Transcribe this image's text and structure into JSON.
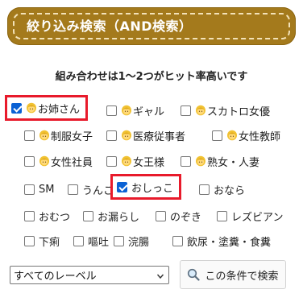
{
  "header": {
    "title": "絞り込み検索（AND検索）"
  },
  "subtitle": "組み合わせは1～2つがヒット率高いです",
  "rows": [
    [
      {
        "label": "お姉さん",
        "checked": true,
        "emoji": true,
        "highlight": true
      },
      {
        "label": "ギャル",
        "checked": false,
        "emoji": true
      },
      {
        "label": "スカトロ女優",
        "checked": false,
        "emoji": true
      }
    ],
    [
      {
        "label": "制服女子",
        "checked": false,
        "emoji": true
      },
      {
        "label": "医療従事者",
        "checked": false,
        "emoji": true
      },
      {
        "label": "女性教師",
        "checked": false,
        "emoji": true
      }
    ],
    [
      {
        "label": "女性社員",
        "checked": false,
        "emoji": true
      },
      {
        "label": "女王様",
        "checked": false,
        "emoji": true
      },
      {
        "label": "熟女・人妻",
        "checked": false,
        "emoji": true
      }
    ],
    [
      {
        "label": "SM",
        "checked": false,
        "emoji": false
      },
      {
        "label": "うんこ",
        "checked": false,
        "emoji": false
      },
      {
        "label": "おしっこ",
        "checked": true,
        "emoji": false,
        "highlight": true
      },
      {
        "label": "おなら",
        "checked": false,
        "emoji": false
      }
    ],
    [
      {
        "label": "おむつ",
        "checked": false,
        "emoji": false
      },
      {
        "label": "お漏らし",
        "checked": false,
        "emoji": false
      },
      {
        "label": "のぞき",
        "checked": false,
        "emoji": false
      },
      {
        "label": "レズビアン",
        "checked": false,
        "emoji": false
      }
    ],
    [
      {
        "label": "下痢",
        "checked": false,
        "emoji": false
      },
      {
        "label": "嘔吐",
        "checked": false,
        "emoji": false
      },
      {
        "label": "浣腸",
        "checked": false,
        "emoji": false
      },
      {
        "label": "飲尿・塗糞・食糞",
        "checked": false,
        "emoji": false
      }
    ]
  ],
  "label_select": {
    "value": "すべてのレーベル"
  },
  "search_button": {
    "label": "この条件で検索"
  },
  "colors": {
    "header_bg": "#a47a1c",
    "highlight": "#e81a2b",
    "checkbox_checked": "#0a61d4"
  },
  "icons": {
    "person": "blond-person-icon",
    "search": "magnifier-icon",
    "dropdown": "chevron-down-icon"
  }
}
